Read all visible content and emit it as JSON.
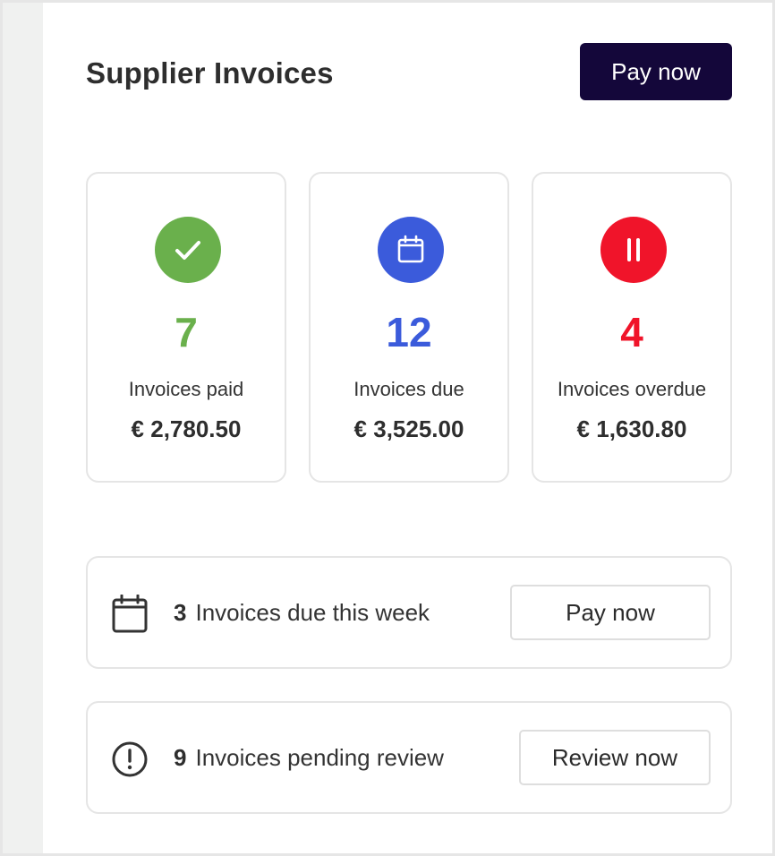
{
  "header": {
    "title": "Supplier Invoices",
    "pay_now_label": "Pay now"
  },
  "colors": {
    "paid": "#6ab04c",
    "due": "#3b5bdb",
    "overdue": "#f0142a",
    "primary_button": "#14073a"
  },
  "stats": [
    {
      "icon": "check-icon",
      "count": "7",
      "label": "Invoices paid",
      "amount": "€ 2,780.50"
    },
    {
      "icon": "calendar-icon",
      "count": "12",
      "label": "Invoices due",
      "amount": "€ 3,525.00"
    },
    {
      "icon": "pause-icon",
      "count": "4",
      "label": "Invoices overdue",
      "amount": "€ 1,630.80"
    }
  ],
  "tasks": [
    {
      "icon": "calendar-icon",
      "count": "3",
      "text": "Invoices due this week",
      "button": "Pay now"
    },
    {
      "icon": "alert-circle-icon",
      "count": "9",
      "text": "Invoices pending review",
      "button": "Review now"
    }
  ]
}
